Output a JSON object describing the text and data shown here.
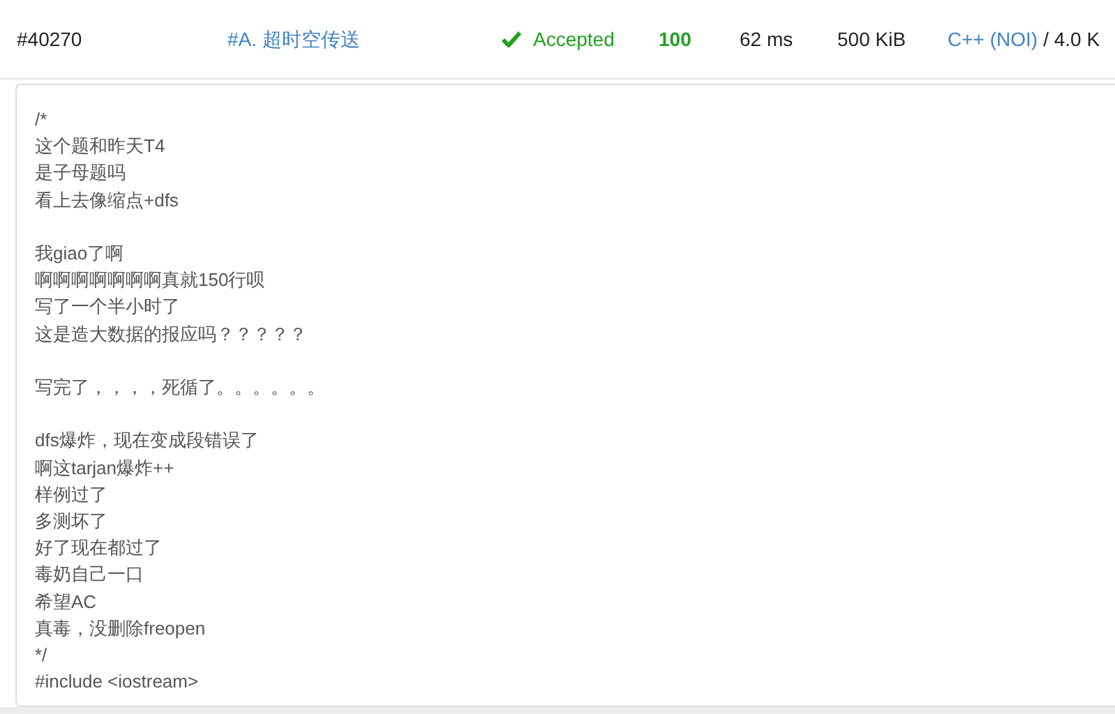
{
  "submission": {
    "id": "#40270",
    "problem": "#A. 超时空传送",
    "status": {
      "kind": "accepted",
      "label": "Accepted"
    },
    "score": "100",
    "time": "62 ms",
    "memory": "500 KiB",
    "language": "C++ (NOI)",
    "code_length": "/ 4.0 K"
  },
  "code_blocks": [
    [
      "/*",
      "这个题和昨天T4",
      "是子母题吗",
      "看上去像缩点+dfs"
    ],
    [
      "我giao了啊",
      "啊啊啊啊啊啊啊真就150行呗",
      "写了一个半小时了",
      "这是造大数据的报应吗？？？？？"
    ],
    [
      "写完了，，，，死循了。。。。。。"
    ],
    [
      "dfs爆炸，现在变成段错误了",
      "啊这tarjan爆炸++",
      "样例过了",
      "多测坏了",
      "好了现在都过了",
      "毒奶自己一口",
      "希望AC",
      "真毒，没删除freopen",
      "*/",
      "#include <iostream>"
    ]
  ]
}
